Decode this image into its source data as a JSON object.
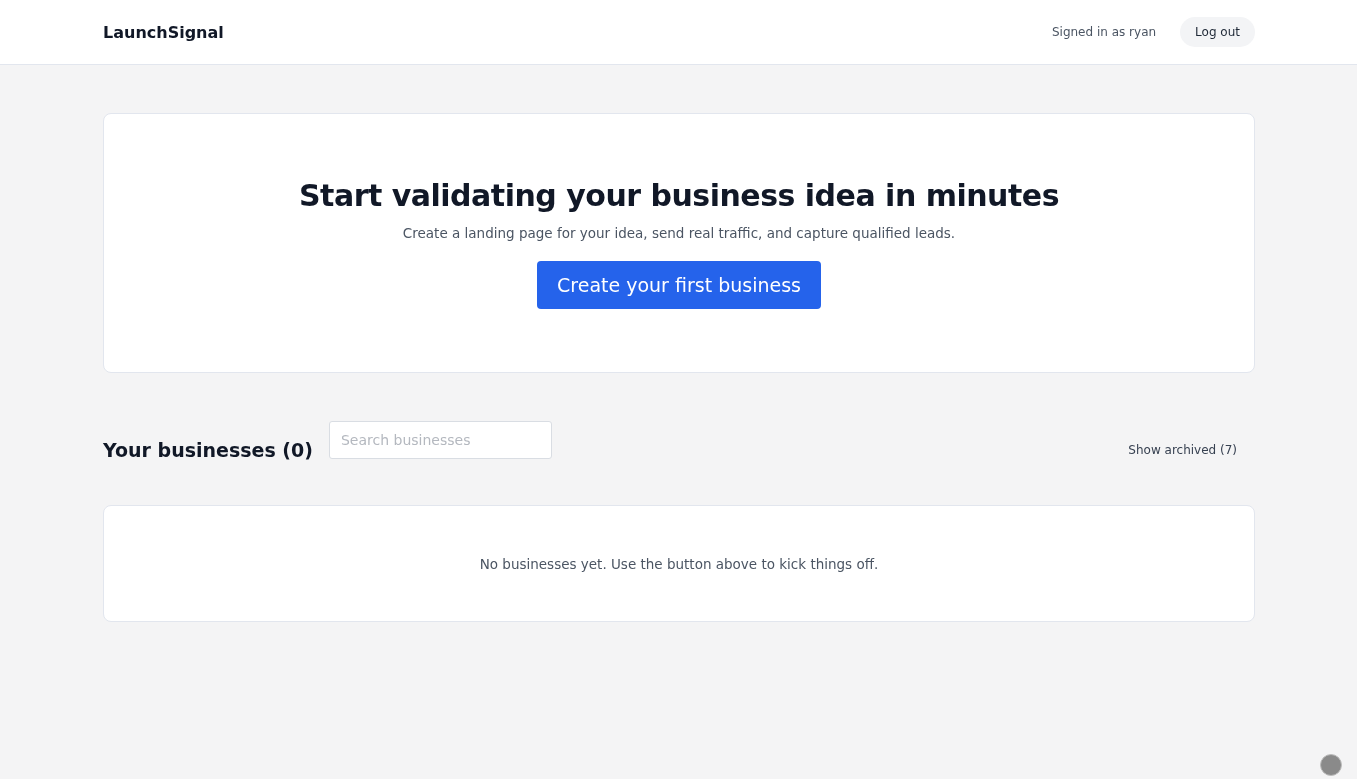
{
  "header": {
    "brand": "LaunchSignal",
    "signed_in": "Signed in as ryan",
    "logout": "Log out"
  },
  "hero": {
    "title": "Start validating your business idea in minutes",
    "subtitle": "Create a landing page for your idea, send real traffic, and capture qualified leads.",
    "cta": "Create your first business"
  },
  "businesses": {
    "heading": "Your businesses (0)",
    "search": {
      "placeholder": "Search businesses"
    },
    "show_archived": "Show archived (7)",
    "empty_message": "No businesses yet. Use the button above to kick things off."
  }
}
